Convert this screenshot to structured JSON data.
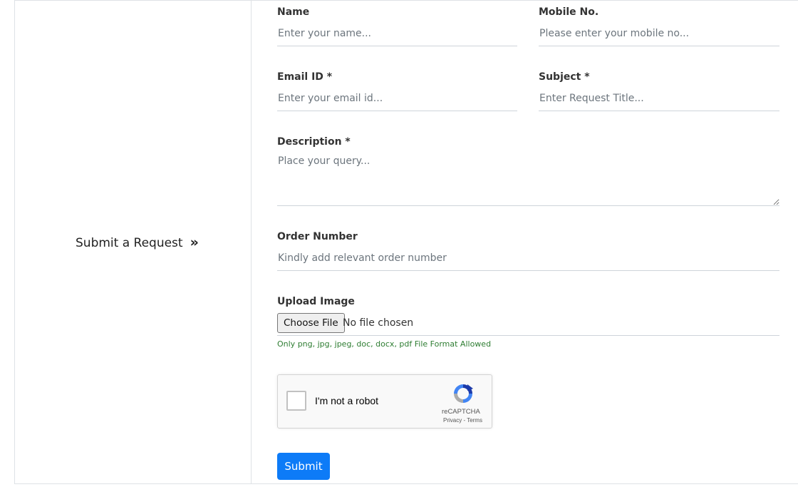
{
  "sidebar": {
    "title": "Submit a Request",
    "arrow": "»"
  },
  "form": {
    "name": {
      "label": "Name",
      "placeholder": "Enter your name..."
    },
    "mobile": {
      "label": "Mobile No.",
      "placeholder": "Please enter your mobile no..."
    },
    "email": {
      "label": "Email ID *",
      "placeholder": "Enter your email id..."
    },
    "subject": {
      "label": "Subject *",
      "placeholder": "Enter Request Title..."
    },
    "description": {
      "label": "Description *",
      "placeholder": "Place your query..."
    },
    "order": {
      "label": "Order Number",
      "placeholder": "Kindly add relevant order number"
    },
    "upload": {
      "label": "Upload Image",
      "button": "Choose File",
      "status": "No file chosen",
      "hint": "Only png, jpg, jpeg, doc, docx, pdf File Format Allowed"
    },
    "captcha": {
      "text": "I'm not a robot",
      "brand": "reCAPTCHA",
      "links": "Privacy - Terms"
    },
    "submit": "Submit"
  },
  "colors": {
    "primary": "#0d7bf7",
    "hint": "#2e7d32",
    "border": "#dee2e6"
  }
}
